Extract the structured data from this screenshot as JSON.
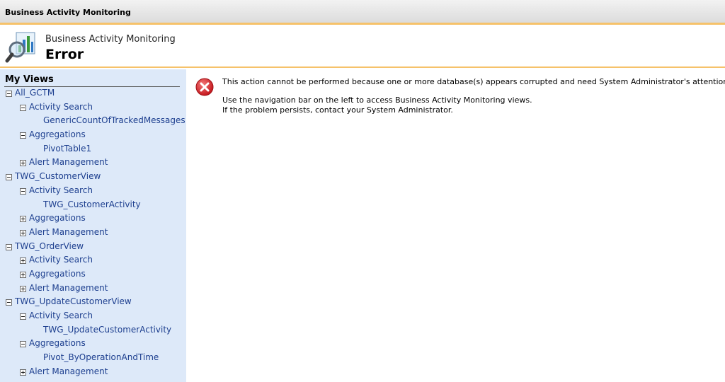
{
  "window": {
    "title": "Business Activity Monitoring"
  },
  "header": {
    "subtitle": "Business Activity Monitoring",
    "title": "Error",
    "logo_icon": "bam-magnifier-chart-icon"
  },
  "sidebar": {
    "heading": "My Views",
    "tree": [
      {
        "level": 0,
        "toggle": "minus",
        "label": "All_GCTM"
      },
      {
        "level": 1,
        "toggle": "minus",
        "label": "Activity Search"
      },
      {
        "level": 2,
        "toggle": "",
        "label": "GenericCountOfTrackedMessages"
      },
      {
        "level": 1,
        "toggle": "minus",
        "label": "Aggregations"
      },
      {
        "level": 2,
        "toggle": "",
        "label": "PivotTable1"
      },
      {
        "level": 1,
        "toggle": "plus",
        "label": "Alert Management"
      },
      {
        "level": 0,
        "toggle": "minus",
        "label": "TWG_CustomerView"
      },
      {
        "level": 1,
        "toggle": "minus",
        "label": "Activity Search"
      },
      {
        "level": 2,
        "toggle": "",
        "label": "TWG_CustomerActivity"
      },
      {
        "level": 1,
        "toggle": "plus",
        "label": "Aggregations"
      },
      {
        "level": 1,
        "toggle": "plus",
        "label": "Alert Management"
      },
      {
        "level": 0,
        "toggle": "minus",
        "label": "TWG_OrderView"
      },
      {
        "level": 1,
        "toggle": "plus",
        "label": "Activity Search"
      },
      {
        "level": 1,
        "toggle": "plus",
        "label": "Aggregations"
      },
      {
        "level": 1,
        "toggle": "plus",
        "label": "Alert Management"
      },
      {
        "level": 0,
        "toggle": "minus",
        "label": "TWG_UpdateCustomerView"
      },
      {
        "level": 1,
        "toggle": "minus",
        "label": "Activity Search"
      },
      {
        "level": 2,
        "toggle": "",
        "label": "TWG_UpdateCustomerActivity"
      },
      {
        "level": 1,
        "toggle": "minus",
        "label": "Aggregations"
      },
      {
        "level": 2,
        "toggle": "",
        "label": "Pivot_ByOperationAndTime"
      },
      {
        "level": 1,
        "toggle": "plus",
        "label": "Alert Management"
      }
    ]
  },
  "main": {
    "error_icon": "error-x-icon",
    "message_primary": "This action cannot be performed because one or more database(s) appears corrupted and need System Administrator's attention.",
    "message_nav": "Use the navigation bar on the left to access Business Activity Monitoring views.",
    "message_contact": "If the problem persists, contact your System Administrator."
  },
  "colors": {
    "accent_rule": "#f6c26a",
    "sidebar_bg": "#dde9f9",
    "link": "#1d3f8f",
    "error_red": "#d9262c"
  }
}
